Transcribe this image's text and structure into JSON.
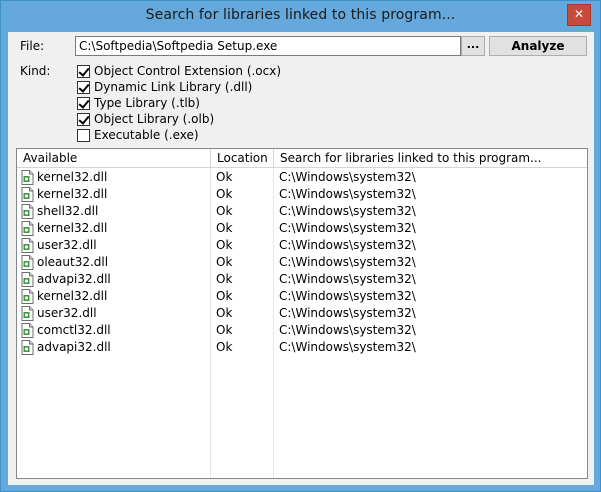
{
  "window": {
    "title": "Search for libraries linked to this program...",
    "close_glyph": "✕"
  },
  "file": {
    "label": "File:",
    "value": "C:\\Softpedia\\Softpedia Setup.exe",
    "browse_label": "...",
    "analyze_label": "Analyze"
  },
  "kind": {
    "label": "Kind:",
    "options": [
      {
        "label": "Object Control Extension (.ocx)",
        "checked": true
      },
      {
        "label": "Dynamic Link Library (.dll)",
        "checked": true
      },
      {
        "label": "Type Library (.tlb)",
        "checked": true
      },
      {
        "label": "Object Library (.olb)",
        "checked": true
      },
      {
        "label": "Executable (.exe)",
        "checked": false
      }
    ]
  },
  "list": {
    "columns": [
      "Available",
      "Location",
      "Search for libraries linked to this program..."
    ],
    "row_icon": "dll-file-icon",
    "rows": [
      {
        "name": "kernel32.dll",
        "status": "Ok",
        "path": "C:\\Windows\\system32\\"
      },
      {
        "name": "kernel32.dll",
        "status": "Ok",
        "path": "C:\\Windows\\system32\\"
      },
      {
        "name": "shell32.dll",
        "status": "Ok",
        "path": "C:\\Windows\\system32\\"
      },
      {
        "name": "kernel32.dll",
        "status": "Ok",
        "path": "C:\\Windows\\system32\\"
      },
      {
        "name": "user32.dll",
        "status": "Ok",
        "path": "C:\\Windows\\system32\\"
      },
      {
        "name": "oleaut32.dll",
        "status": "Ok",
        "path": "C:\\Windows\\system32\\"
      },
      {
        "name": "advapi32.dll",
        "status": "Ok",
        "path": "C:\\Windows\\system32\\"
      },
      {
        "name": "kernel32.dll",
        "status": "Ok",
        "path": "C:\\Windows\\system32\\"
      },
      {
        "name": "user32.dll",
        "status": "Ok",
        "path": "C:\\Windows\\system32\\"
      },
      {
        "name": "comctl32.dll",
        "status": "Ok",
        "path": "C:\\Windows\\system32\\"
      },
      {
        "name": "advapi32.dll",
        "status": "Ok",
        "path": "C:\\Windows\\system32\\"
      }
    ]
  },
  "colors": {
    "titlebar": "#65a9dc",
    "close_button": "#c74b3d"
  }
}
